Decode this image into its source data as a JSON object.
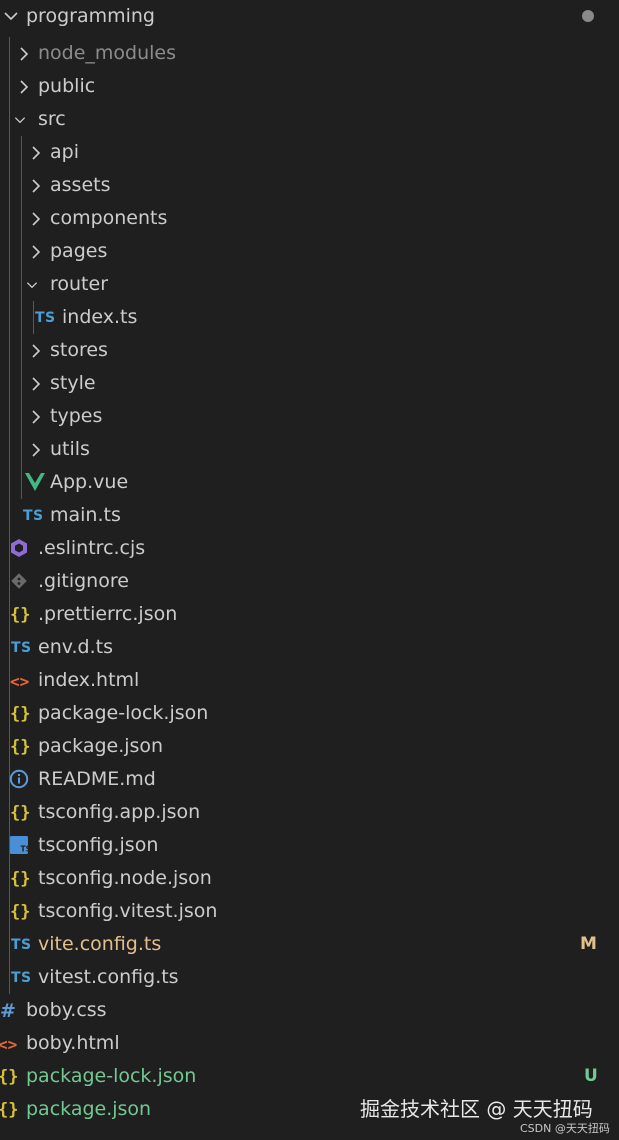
{
  "explorer": {
    "folder_name": "programming",
    "colors": {
      "default_text": "#cccccc",
      "ignored_text": "#8c8c8c",
      "modified_text": "#e2c08d",
      "untracked_text": "#73c991"
    }
  },
  "items": [
    {
      "label": "node_modules",
      "type": "folder",
      "expanded": false,
      "icon": "chevron-right-icon"
    },
    {
      "label": "public",
      "type": "folder",
      "expanded": false,
      "icon": "chevron-right-icon"
    },
    {
      "label": "src",
      "type": "folder",
      "expanded": true,
      "icon": "chevron-down-icon"
    },
    {
      "label": "api",
      "type": "folder",
      "expanded": false,
      "icon": "chevron-right-icon"
    },
    {
      "label": "assets",
      "type": "folder",
      "expanded": false,
      "icon": "chevron-right-icon"
    },
    {
      "label": "components",
      "type": "folder",
      "expanded": false,
      "icon": "chevron-right-icon"
    },
    {
      "label": "pages",
      "type": "folder",
      "expanded": false,
      "icon": "chevron-right-icon"
    },
    {
      "label": "router",
      "type": "folder",
      "expanded": true,
      "icon": "chevron-down-icon"
    },
    {
      "label": "index.ts",
      "type": "file",
      "icon": "typescript-icon",
      "icon_text": "TS"
    },
    {
      "label": "stores",
      "type": "folder",
      "expanded": false,
      "icon": "chevron-right-icon"
    },
    {
      "label": "style",
      "type": "folder",
      "expanded": false,
      "icon": "chevron-right-icon"
    },
    {
      "label": "types",
      "type": "folder",
      "expanded": false,
      "icon": "chevron-right-icon"
    },
    {
      "label": "utils",
      "type": "folder",
      "expanded": false,
      "icon": "chevron-right-icon"
    },
    {
      "label": "App.vue",
      "type": "file",
      "icon": "vue-icon"
    },
    {
      "label": "main.ts",
      "type": "file",
      "icon": "typescript-icon",
      "icon_text": "TS"
    },
    {
      "label": ".eslintrc.cjs",
      "type": "file",
      "icon": "eslint-icon"
    },
    {
      "label": ".gitignore",
      "type": "file",
      "icon": "git-icon"
    },
    {
      "label": ".prettierrc.json",
      "type": "file",
      "icon": "json-icon",
      "icon_text": "{}"
    },
    {
      "label": "env.d.ts",
      "type": "file",
      "icon": "typescript-icon",
      "icon_text": "TS"
    },
    {
      "label": "index.html",
      "type": "file",
      "icon": "html-icon",
      "icon_text": "<>"
    },
    {
      "label": "package-lock.json",
      "type": "file",
      "icon": "json-icon",
      "icon_text": "{}"
    },
    {
      "label": "package.json",
      "type": "file",
      "icon": "json-icon",
      "icon_text": "{}"
    },
    {
      "label": "README.md",
      "type": "file",
      "icon": "info-icon"
    },
    {
      "label": "tsconfig.app.json",
      "type": "file",
      "icon": "json-icon",
      "icon_text": "{}"
    },
    {
      "label": "tsconfig.json",
      "type": "file",
      "icon": "tsconfig-icon"
    },
    {
      "label": "tsconfig.node.json",
      "type": "file",
      "icon": "json-icon",
      "icon_text": "{}"
    },
    {
      "label": "tsconfig.vitest.json",
      "type": "file",
      "icon": "json-icon",
      "icon_text": "{}"
    },
    {
      "label": "vite.config.ts",
      "type": "file",
      "icon": "typescript-icon",
      "icon_text": "TS",
      "status": "M"
    },
    {
      "label": "vitest.config.ts",
      "type": "file",
      "icon": "typescript-icon",
      "icon_text": "TS"
    },
    {
      "label": "boby.css",
      "type": "file",
      "icon": "css-icon",
      "icon_text": "#"
    },
    {
      "label": "boby.html",
      "type": "file",
      "icon": "html-icon",
      "icon_text": "<>"
    },
    {
      "label": "package-lock.json",
      "type": "file",
      "icon": "json-icon",
      "icon_text": "{}",
      "status": "U"
    },
    {
      "label": "package.json",
      "type": "file",
      "icon": "json-icon",
      "icon_text": "{}"
    }
  ],
  "watermark": {
    "main": "掘金技术社区 @ 天天扭码",
    "sub": "CSDN @天天扭码"
  }
}
